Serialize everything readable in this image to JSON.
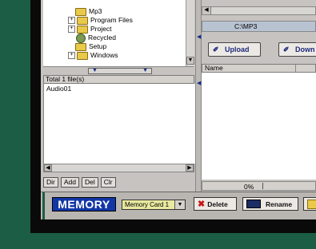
{
  "tree": {
    "items": [
      {
        "label": "Mp3",
        "icon": "folder-icon",
        "expander": ""
      },
      {
        "label": "Program Files",
        "icon": "folder-icon",
        "expander": "+"
      },
      {
        "label": "Project",
        "icon": "folder-icon",
        "expander": "+"
      },
      {
        "label": "Recycled",
        "icon": "recycle-bin-icon",
        "expander": ""
      },
      {
        "label": "Setup",
        "icon": "folder-icon",
        "expander": ""
      },
      {
        "label": "Windows",
        "icon": "folder-icon",
        "expander": "+"
      }
    ]
  },
  "file_panel": {
    "total_label": "Total 1 file(s)",
    "files": [
      "Audio01"
    ]
  },
  "left_buttons": [
    "Dir",
    "Add",
    "Del",
    "Clr"
  ],
  "right_panel": {
    "path": "C:\\MP3",
    "upload_label": "Upload",
    "download_label": "Down",
    "column_name": "Name",
    "progress": "0%"
  },
  "bottom": {
    "device_label": "MEMORY",
    "card_selected": "Memory Card 1",
    "delete_label": "Delete",
    "rename_label": "Rename"
  }
}
